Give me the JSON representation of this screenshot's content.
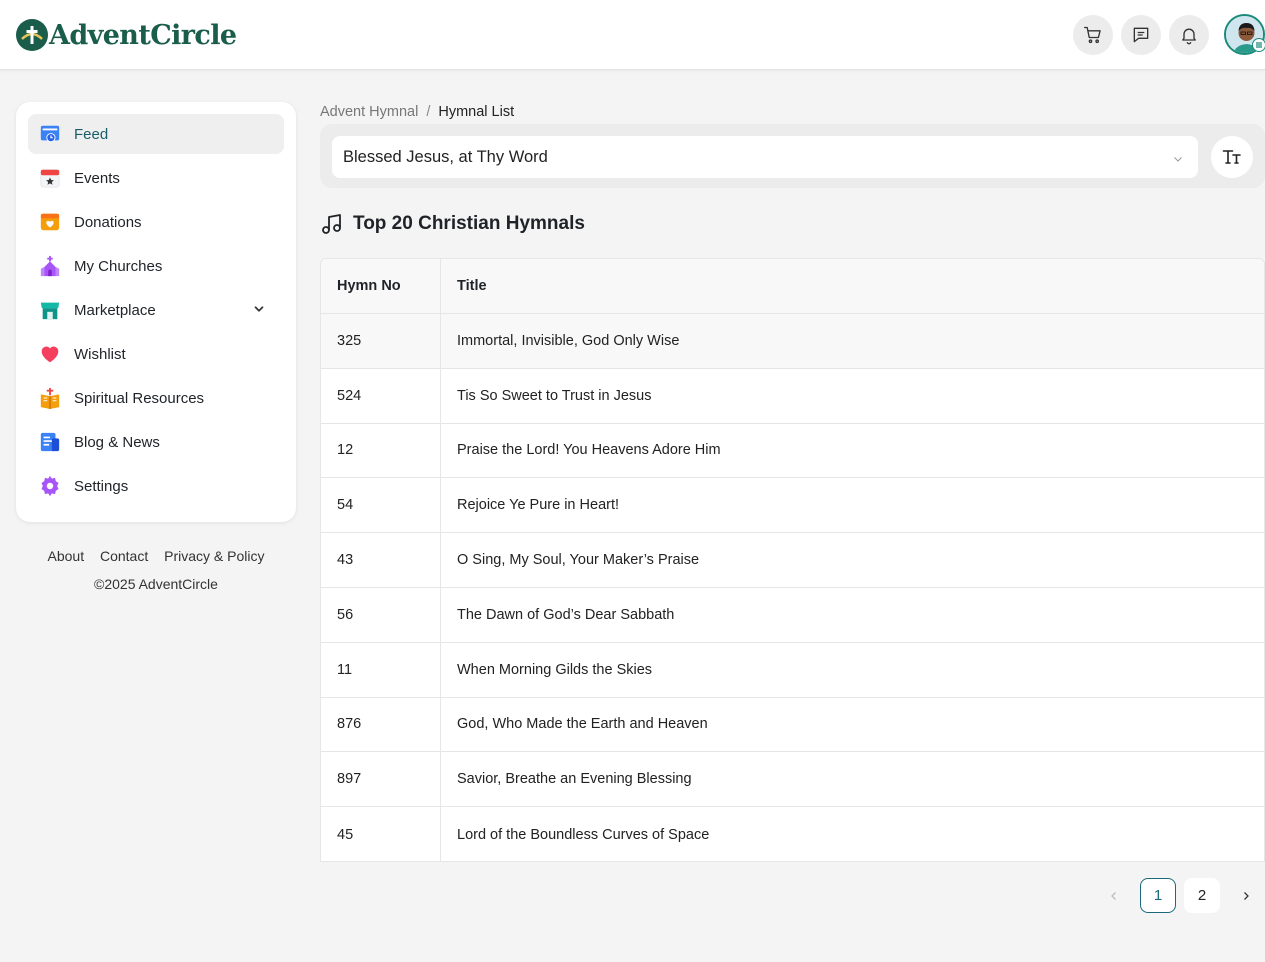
{
  "header": {
    "brand": "AdventCircle",
    "icons": [
      "cart-icon",
      "message-icon",
      "bell-icon"
    ],
    "accent": "#1a5d4a"
  },
  "sidebar": {
    "items": [
      {
        "label": "Feed",
        "icon": "feed-icon",
        "active": true
      },
      {
        "label": "Events",
        "icon": "calendar-icon"
      },
      {
        "label": "Donations",
        "icon": "donation-box-icon"
      },
      {
        "label": "My Churches",
        "icon": "church-icon"
      },
      {
        "label": "Marketplace",
        "icon": "store-icon",
        "expandable": true
      },
      {
        "label": "Wishlist",
        "icon": "heart-icon"
      },
      {
        "label": "Spiritual Resources",
        "icon": "bible-icon"
      },
      {
        "label": "Blog & News",
        "icon": "news-icon"
      },
      {
        "label": "Settings",
        "icon": "gear-icon"
      }
    ]
  },
  "footer": {
    "links": [
      "About",
      "Contact",
      "Privacy & Policy"
    ],
    "copyright": "©2025 AdventCircle"
  },
  "breadcrumb": {
    "parent": "Advent Hymnal",
    "separator": "/",
    "current": "Hymnal List"
  },
  "hymn_select": {
    "value": "Blessed Jesus, at Thy Word",
    "font_button": "TT"
  },
  "section": {
    "title": "Top 20 Christian Hymnals"
  },
  "table": {
    "columns": [
      "Hymn No",
      "Title"
    ],
    "rows": [
      {
        "no": "325",
        "title": "Immortal, Invisible, God Only Wise"
      },
      {
        "no": "524",
        "title": "Tis So Sweet to Trust in Jesus"
      },
      {
        "no": "12",
        "title": "Praise the Lord! You Heavens Adore Him"
      },
      {
        "no": "54",
        "title": "Rejoice Ye Pure in Heart!"
      },
      {
        "no": "43",
        "title": "O Sing, My Soul, Your Maker’s Praise"
      },
      {
        "no": "56",
        "title": "The Dawn of God’s Dear Sabbath"
      },
      {
        "no": "11",
        "title": "When Morning Gilds the Skies"
      },
      {
        "no": "876",
        "title": "God, Who Made the Earth and Heaven"
      },
      {
        "no": "897",
        "title": "Savior, Breathe an Evening Blessing"
      },
      {
        "no": "45",
        "title": "Lord of the Boundless Curves of Space"
      }
    ]
  },
  "pagination": {
    "pages": [
      "1",
      "2"
    ],
    "current": "1"
  }
}
